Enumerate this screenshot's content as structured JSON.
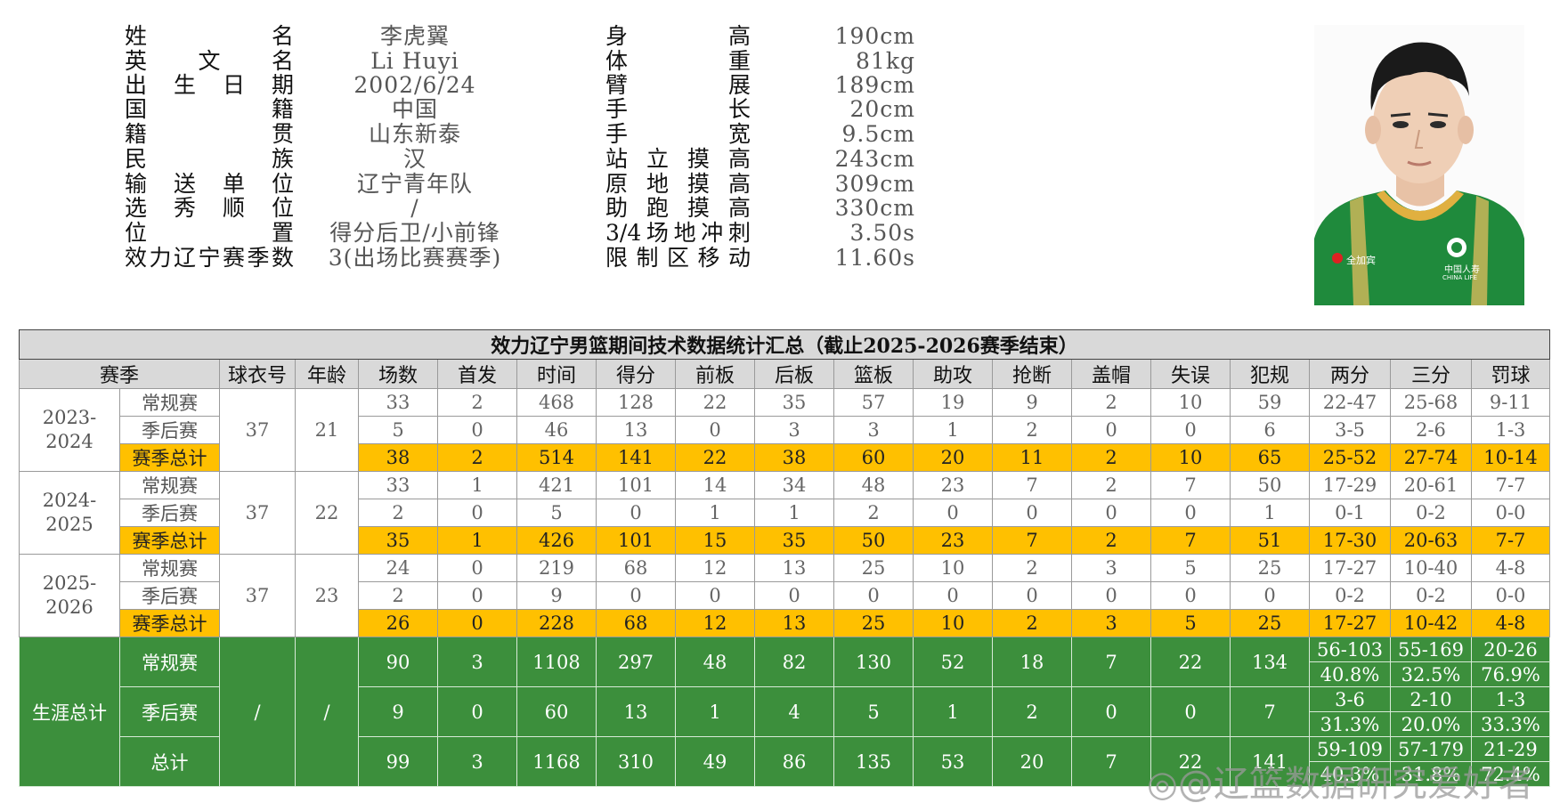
{
  "profile": {
    "left": [
      {
        "label": "姓名",
        "value": "李虎翼"
      },
      {
        "label": "英文名",
        "value": "Li Huyi"
      },
      {
        "label": "出生日期",
        "value": "2002/6/24"
      },
      {
        "label": "国籍",
        "value": "中国"
      },
      {
        "label": "籍贯",
        "value": "山东新泰"
      },
      {
        "label": "民族",
        "value": "汉"
      },
      {
        "label": "输送单位",
        "value": "辽宁青年队"
      },
      {
        "label": "选秀顺位",
        "value": "/"
      },
      {
        "label": "位置",
        "value": "得分后卫/小前锋"
      },
      {
        "label": "效力辽宁赛季数",
        "value": "3(出场比赛赛季)"
      }
    ],
    "right": [
      {
        "label": "身高",
        "value": "190cm"
      },
      {
        "label": "体重",
        "value": "81kg"
      },
      {
        "label": "臂展",
        "value": "189cm"
      },
      {
        "label": "手长",
        "value": "20cm"
      },
      {
        "label": "手宽",
        "value": "9.5cm"
      },
      {
        "label": "站立摸高",
        "value": "243cm"
      },
      {
        "label": "原地摸高",
        "value": "309cm"
      },
      {
        "label": "助跑摸高",
        "value": "330cm"
      },
      {
        "label": "3/4场地冲刺",
        "value": "3.50s"
      },
      {
        "label": "限制区移动",
        "value": "11.60s"
      }
    ],
    "photo_logos": [
      "全加宾",
      "中国人寿",
      "CHINA LIFE"
    ]
  },
  "table": {
    "title": "效力辽宁男篮期间技术数据统计汇总（截止2025-2026赛季结束）",
    "headers": [
      "赛季",
      "球衣号",
      "年龄",
      "场数",
      "首发",
      "时间",
      "得分",
      "前板",
      "后板",
      "篮板",
      "助攻",
      "抢断",
      "盖帽",
      "失误",
      "犯规",
      "两分",
      "三分",
      "罚球"
    ],
    "seasons": [
      {
        "season": "2023-2024",
        "jersey": "37",
        "age": "21",
        "rows": [
          {
            "kind": "常规赛",
            "cells": [
              "33",
              "2",
              "468",
              "128",
              "22",
              "35",
              "57",
              "19",
              "9",
              "2",
              "10",
              "59",
              "22-47",
              "25-68",
              "9-11"
            ]
          },
          {
            "kind": "季后赛",
            "cells": [
              "5",
              "0",
              "46",
              "13",
              "0",
              "3",
              "3",
              "1",
              "2",
              "0",
              "0",
              "6",
              "3-5",
              "2-6",
              "1-3"
            ]
          },
          {
            "kind": "赛季总计",
            "cells": [
              "38",
              "2",
              "514",
              "141",
              "22",
              "38",
              "60",
              "20",
              "11",
              "2",
              "10",
              "65",
              "25-52",
              "27-74",
              "10-14"
            ]
          }
        ]
      },
      {
        "season": "2024-2025",
        "jersey": "37",
        "age": "22",
        "rows": [
          {
            "kind": "常规赛",
            "cells": [
              "33",
              "1",
              "421",
              "101",
              "14",
              "34",
              "48",
              "23",
              "7",
              "2",
              "7",
              "50",
              "17-29",
              "20-61",
              "7-7"
            ]
          },
          {
            "kind": "季后赛",
            "cells": [
              "2",
              "0",
              "5",
              "0",
              "1",
              "1",
              "2",
              "0",
              "0",
              "0",
              "0",
              "1",
              "0-1",
              "0-2",
              "0-0"
            ]
          },
          {
            "kind": "赛季总计",
            "cells": [
              "35",
              "1",
              "426",
              "101",
              "15",
              "35",
              "50",
              "23",
              "7",
              "2",
              "7",
              "51",
              "17-30",
              "20-63",
              "7-7"
            ]
          }
        ]
      },
      {
        "season": "2025-2026",
        "jersey": "37",
        "age": "23",
        "rows": [
          {
            "kind": "常规赛",
            "cells": [
              "24",
              "0",
              "219",
              "68",
              "12",
              "13",
              "25",
              "10",
              "2",
              "3",
              "5",
              "25",
              "17-27",
              "10-40",
              "4-8"
            ]
          },
          {
            "kind": "季后赛",
            "cells": [
              "2",
              "0",
              "9",
              "0",
              "0",
              "0",
              "0",
              "0",
              "0",
              "0",
              "0",
              "0",
              "0-2",
              "0-2",
              "0-0"
            ]
          },
          {
            "kind": "赛季总计",
            "cells": [
              "26",
              "0",
              "228",
              "68",
              "12",
              "13",
              "25",
              "10",
              "2",
              "3",
              "5",
              "25",
              "17-27",
              "10-42",
              "4-8"
            ]
          }
        ]
      }
    ],
    "career": {
      "label": "生涯总计",
      "jersey": "/",
      "age": "/",
      "rows": [
        {
          "kind": "常规赛",
          "cells": [
            "90",
            "3",
            "1108",
            "297",
            "48",
            "82",
            "130",
            "52",
            "18",
            "7",
            "22",
            "134"
          ],
          "shots": [
            [
              "56-103",
              "40.8%"
            ],
            [
              "55-169",
              "32.5%"
            ],
            [
              "20-26",
              "76.9%"
            ]
          ]
        },
        {
          "kind": "季后赛",
          "cells": [
            "9",
            "0",
            "60",
            "13",
            "1",
            "4",
            "5",
            "1",
            "2",
            "0",
            "0",
            "7"
          ],
          "shots": [
            [
              "3-6",
              "31.3%"
            ],
            [
              "2-10",
              "20.0%"
            ],
            [
              "1-3",
              "33.3%"
            ]
          ]
        },
        {
          "kind": "总计",
          "cells": [
            "99",
            "3",
            "1168",
            "310",
            "49",
            "86",
            "135",
            "53",
            "20",
            "7",
            "22",
            "141"
          ],
          "shots": [
            [
              "59-109",
              "40.3%"
            ],
            [
              "57-179",
              "31.8%"
            ],
            [
              "21-29",
              "72.4%"
            ]
          ]
        }
      ]
    }
  },
  "watermark": "@辽篮数据研究爱好者",
  "colors": {
    "total_row": "#ffc000",
    "career_bg": "#3c8f3c",
    "header_bg": "#d9d9d9"
  }
}
